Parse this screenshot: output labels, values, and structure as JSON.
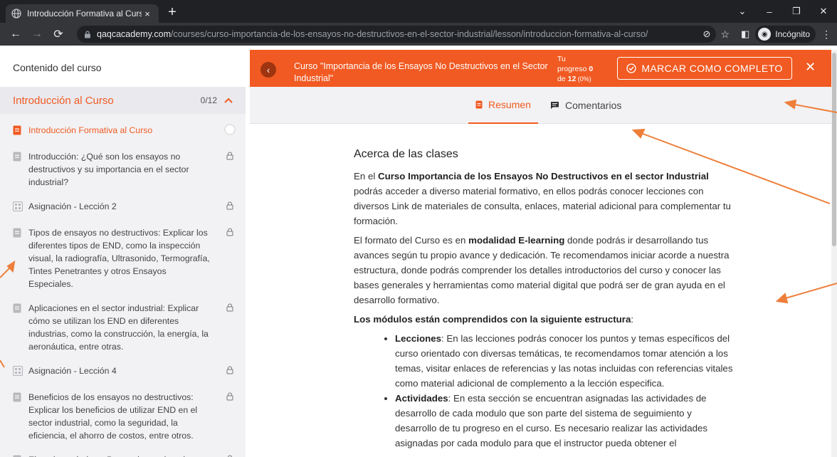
{
  "browser": {
    "tab_title": "Introducción Formativa al Curso |",
    "tab_close": "×",
    "new_tab": "+",
    "url_host": "qaqcacademy.com",
    "url_path": "/courses/curso-importancia-de-los-ensayos-no-destructivos-en-el-sector-industrial/lesson/introduccion-formativa-al-curso/",
    "profile_label": "Incógnito",
    "window_controls": [
      "⌄",
      "–",
      "❐",
      "✕"
    ]
  },
  "sidebar": {
    "header": "Contenido del curso",
    "section": {
      "title": "Introducción al Curso",
      "count": "0/12"
    },
    "lessons": [
      {
        "label": "Introducción Formativa al Curso",
        "icon": "document-icon",
        "status": "circle",
        "active": true
      },
      {
        "label": "Introducción: ¿Qué son los ensayos no destructivos y su importancia en el sector industrial?",
        "icon": "document-icon",
        "status": "lock"
      },
      {
        "label": "Asignación - Lección 2",
        "icon": "assignment-icon",
        "status": "lock"
      },
      {
        "label": "Tipos de ensayos no destructivos: Explicar los diferentes tipos de END, como la inspección visual, la radiografía, Ultrasonido, Termografía, Tintes Penetrantes y otros Ensayos Especiales.",
        "icon": "document-icon",
        "status": "lock"
      },
      {
        "label": "Aplicaciones en el sector industrial: Explicar cómo se utilizan los END en diferentes industrias, como la construcción, la energía, la aeronáutica, entre otras.",
        "icon": "document-icon",
        "status": "lock"
      },
      {
        "label": "Asignación - Lección 4",
        "icon": "assignment-icon",
        "status": "lock"
      },
      {
        "label": "Beneficios de los ensayos no destructivos: Explicar los beneficios de utilizar END en el sector industrial, como la seguridad, la eficiencia, el ahorro de costos, entre otros.",
        "icon": "document-icon",
        "status": "lock"
      },
      {
        "label": "Ejemplos prácticos: Proporcionar ejemplos",
        "icon": "document-icon",
        "status": "lock"
      }
    ]
  },
  "topbar": {
    "back": "‹",
    "course_title": "Curso \"Importancia de los Ensayos No Destructivos en el Sector Industrial\"",
    "progress_line1": "Tu",
    "progress_line2a": "progreso ",
    "progress_value": "0",
    "progress_line3a": "de ",
    "progress_total": "12",
    "progress_pct": " (0%)",
    "mark_complete": "MARCAR COMO COMPLETO",
    "close": "✕"
  },
  "tabs": [
    {
      "label": "Resumen",
      "selected": true
    },
    {
      "label": "Comentarios",
      "selected": false
    }
  ],
  "content": {
    "heading": "Acerca de las clases",
    "p1_a": "En el ",
    "p1_b": "Curso Importancia de los Ensayos No Destructivos en el sector Industrial",
    "p1_c": "  podrás acceder a diverso material formativo, en ellos podrás conocer lecciones con diversos Link de materiales de consulta, enlaces, material adicional para complementar tu formación.",
    "p2_a": "El formato del Curso es en ",
    "p2_b": "modalidad E-learning",
    "p2_c": " donde podrás ir desarrollando tus avances según tu propio avance y dedicación. Te recomendamos iniciar acorde a nuestra estructura, donde podrás comprender los detalles introductorios del curso y conocer las bases generales y herramientas como material digital que podrá ser de gran ayuda en el desarrollo formativo.",
    "p3_b": "Los módulos están comprendidos con la siguiente estructura",
    "p3_c": ":",
    "li1_b": "Lecciones",
    "li1_c": ": En las lecciones podrás conocer los puntos y temas específicos del curso orientado con diversas temáticas, te recomendamos tomar atención a los temas, visitar enlaces de referencias y las notas incluidas con referencias vitales como material adicional de complemento a la lección especifica.",
    "li2_b": "Actividades",
    "li2_c": ": En esta sección se encuentran asignadas las actividades de desarrollo de cada modulo que son parte del sistema de seguimiento y desarrollo de tu progreso en el curso. Es necesario realizar las actividades asignadas por cada modulo para que el instructor pueda obtener el"
  },
  "colors": {
    "accent": "#f15a22",
    "chrome_dark": "#202124",
    "chrome_mid": "#35363a",
    "sidebar_bg": "#f2f2f4"
  }
}
